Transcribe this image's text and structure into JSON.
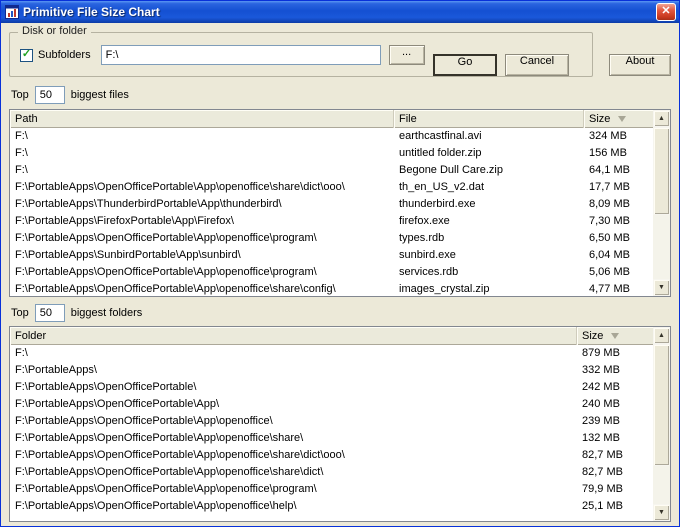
{
  "theme": {
    "titlebar_blue": "#1450d2",
    "window_background": "#ece9d8",
    "table_background": "#ffffff",
    "close_red": "#c93b20"
  },
  "icons": {
    "close": "✕",
    "check": "✓",
    "up_arrow": "▲",
    "down_arrow": "▼"
  },
  "window": {
    "title": "Primitive File Size Chart"
  },
  "controls": {
    "group_label": "Disk or folder",
    "subfolders_label": "Subfolders",
    "path_value": "F:\\",
    "browse_label": "...",
    "go_label": "Go",
    "cancel_label": "Cancel",
    "about_label": "About"
  },
  "files_section": {
    "top_label": "Top",
    "count_value": "50",
    "suffix": "biggest files",
    "columns": [
      "Path",
      "File",
      "Size"
    ],
    "rows": [
      {
        "path": "F:\\",
        "file": "earthcastfinal.avi",
        "size": "324 MB"
      },
      {
        "path": "F:\\",
        "file": "untitled folder.zip",
        "size": "156 MB"
      },
      {
        "path": "F:\\",
        "file": "Begone Dull Care.zip",
        "size": "64,1 MB"
      },
      {
        "path": "F:\\PortableApps\\OpenOfficePortable\\App\\openoffice\\share\\dict\\ooo\\",
        "file": "th_en_US_v2.dat",
        "size": "17,7 MB"
      },
      {
        "path": "F:\\PortableApps\\ThunderbirdPortable\\App\\thunderbird\\",
        "file": "thunderbird.exe",
        "size": "8,09 MB"
      },
      {
        "path": "F:\\PortableApps\\FirefoxPortable\\App\\Firefox\\",
        "file": "firefox.exe",
        "size": "7,30 MB"
      },
      {
        "path": "F:\\PortableApps\\OpenOfficePortable\\App\\openoffice\\program\\",
        "file": "types.rdb",
        "size": "6,50 MB"
      },
      {
        "path": "F:\\PortableApps\\SunbirdPortable\\App\\sunbird\\",
        "file": "sunbird.exe",
        "size": "6,04 MB"
      },
      {
        "path": "F:\\PortableApps\\OpenOfficePortable\\App\\openoffice\\program\\",
        "file": "services.rdb",
        "size": "5,06 MB"
      },
      {
        "path": "F:\\PortableApps\\OpenOfficePortable\\App\\openoffice\\share\\config\\",
        "file": "images_crystal.zip",
        "size": "4,77 MB"
      }
    ]
  },
  "folders_section": {
    "top_label": "Top",
    "count_value": "50",
    "suffix": "biggest folders",
    "columns": [
      "Folder",
      "Size"
    ],
    "rows": [
      {
        "folder": "F:\\",
        "size": "879 MB"
      },
      {
        "folder": "F:\\PortableApps\\",
        "size": "332 MB"
      },
      {
        "folder": "F:\\PortableApps\\OpenOfficePortable\\",
        "size": "242 MB"
      },
      {
        "folder": "F:\\PortableApps\\OpenOfficePortable\\App\\",
        "size": "240 MB"
      },
      {
        "folder": "F:\\PortableApps\\OpenOfficePortable\\App\\openoffice\\",
        "size": "239 MB"
      },
      {
        "folder": "F:\\PortableApps\\OpenOfficePortable\\App\\openoffice\\share\\",
        "size": "132 MB"
      },
      {
        "folder": "F:\\PortableApps\\OpenOfficePortable\\App\\openoffice\\share\\dict\\ooo\\",
        "size": "82,7 MB"
      },
      {
        "folder": "F:\\PortableApps\\OpenOfficePortable\\App\\openoffice\\share\\dict\\",
        "size": "82,7 MB"
      },
      {
        "folder": "F:\\PortableApps\\OpenOfficePortable\\App\\openoffice\\program\\",
        "size": "79,9 MB"
      },
      {
        "folder": "F:\\PortableApps\\OpenOfficePortable\\App\\openoffice\\help\\",
        "size": "25,1 MB"
      }
    ]
  }
}
